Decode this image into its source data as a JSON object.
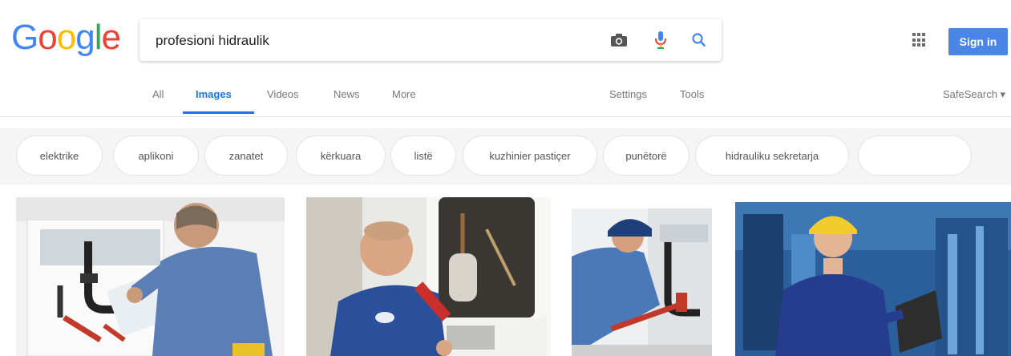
{
  "logo": {
    "text": [
      "G",
      "o",
      "o",
      "g",
      "l",
      "e"
    ],
    "colors": [
      "#4285f4",
      "#ea4335",
      "#fbbc05",
      "#4285f4",
      "#34a853",
      "#ea4335"
    ]
  },
  "search": {
    "query": "profesioni hidraulik",
    "camera_icon": "camera-icon",
    "mic_icon": "mic-icon",
    "search_icon": "search-icon"
  },
  "header": {
    "apps_icon": "apps-icon",
    "signin_label": "Sign in",
    "accent": "#4a86e8"
  },
  "tabs": [
    {
      "label": "All",
      "active": false
    },
    {
      "label": "Images",
      "active": true
    },
    {
      "label": "Videos",
      "active": false
    },
    {
      "label": "News",
      "active": false
    },
    {
      "label": "More",
      "active": false
    }
  ],
  "tools": {
    "settings": "Settings",
    "tools": "Tools",
    "safesearch": "SafeSearch ▾"
  },
  "chips": [
    "elektrike",
    "aplikoni",
    "zanatet",
    "kërkuara",
    "listë",
    "kuzhinier pastiçer",
    "punëtorë",
    "hidrauliku sekretarja",
    ""
  ],
  "images": [
    {
      "alt": "plumber under sink",
      "icon": "plumber-sink-image"
    },
    {
      "alt": "technician smiling",
      "icon": "technician-image"
    },
    {
      "alt": "plumber with wrench",
      "icon": "plumber-wrench-image"
    },
    {
      "alt": "worker with laptop",
      "icon": "worker-laptop-image"
    }
  ]
}
